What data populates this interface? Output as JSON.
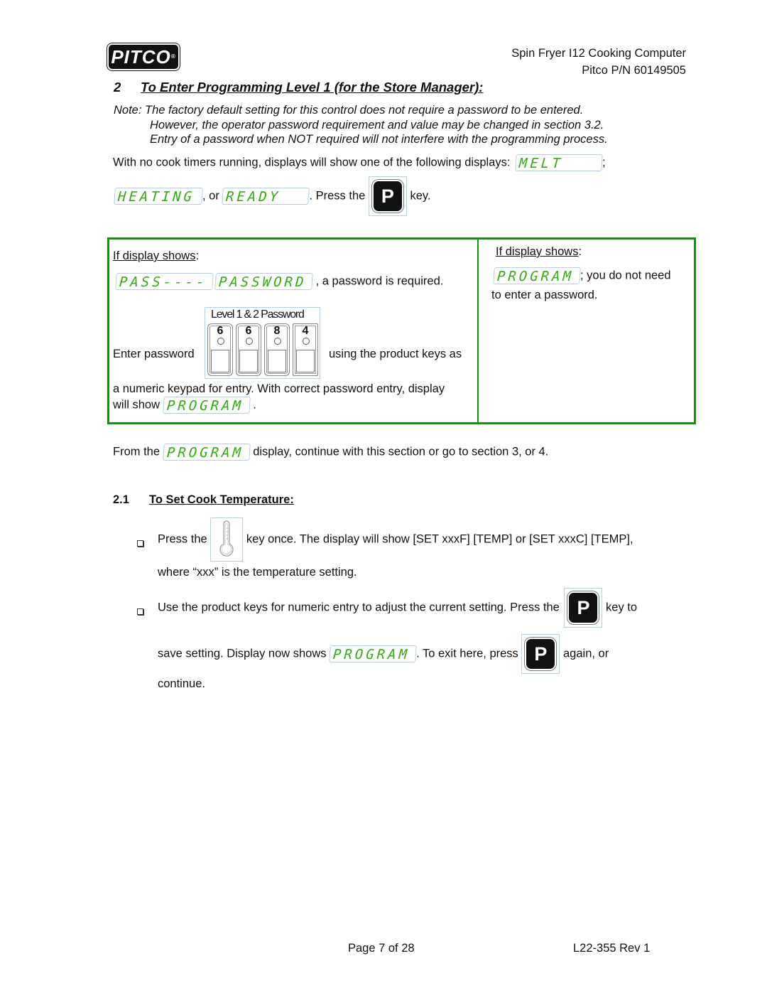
{
  "header": {
    "logo": "PITCO",
    "logo_mark": "®",
    "product": "Spin Fryer I12 Cooking Computer",
    "part_number": "Pitco P/N 60149505"
  },
  "section": {
    "number": "2",
    "title": "To Enter Programming Level 1 (for the Store Manager):"
  },
  "note": {
    "line1": "Note: The factory default setting for this control does not require a password to be entered.",
    "line2": "However, the operator password requirement and value may be changed in section 3.2.",
    "line3": "Entry of a password when NOT required will not interfere with the programming process."
  },
  "intro": {
    "text1": "With no cook timers running, displays will show one of the following displays:",
    "display_melt": "MELT",
    "sep1": ";",
    "display_heating": "HEATING",
    "or": ", or",
    "display_ready": "READY",
    "press": ".  Press the",
    "key_p": "P",
    "key_suffix": "key."
  },
  "box": {
    "left": {
      "if_label": "If display shows",
      "colon": ":",
      "display_pass": "PASS----",
      "display_password": "PASSWORD",
      "required_text": ", a password is required.",
      "enter_password": "Enter password",
      "keypad_title": "Level 1 & 2 Password",
      "keypad_digits": [
        "6",
        "6",
        "8",
        "4"
      ],
      "using_text": "using the product keys as",
      "numeric_text": "a numeric keypad for entry.  With correct password entry, display",
      "will_show": "will show",
      "display_program": "PROGRAM",
      "period": "."
    },
    "right": {
      "if_label": "If display shows",
      "colon": ":",
      "display_program": "PROGRAM",
      "no_need": "; you do not need",
      "to_enter": "to enter a password."
    }
  },
  "from_line": {
    "from": "From the",
    "display_program": "PROGRAM",
    "rest": "display, continue with this section or go to section 3, or 4."
  },
  "subsection": {
    "number": "2.1",
    "title": "To Set Cook Temperature:"
  },
  "steps": [
    {
      "press": "Press the",
      "icon": "thermometer-key",
      "after": "key once.   The display will show [SET xxxF] [TEMP] or [SET xxxC] [TEMP],",
      "line2": "where “xxx” is the temperature setting."
    },
    {
      "text1": "Use the product keys for numeric entry to adjust the current setting.  Press the",
      "key_p": "P",
      "key_to": "key to",
      "save": "save setting.  Display now shows",
      "display_program": "PROGRAM",
      "exit": ".  To exit here, press",
      "again": "again, or",
      "continue": "continue."
    }
  ],
  "footer": {
    "page": "Page 7 of 28",
    "doc": "L22-355 Rev 1"
  },
  "colors": {
    "lcd_text": "#3aa61a",
    "box_border": "#1a8a1a",
    "frame_border": "#b9cde8"
  }
}
